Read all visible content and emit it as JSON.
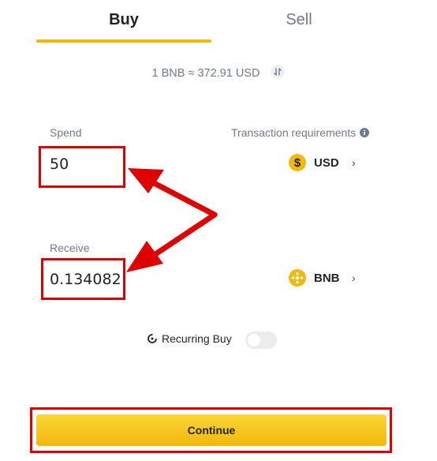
{
  "tabs": {
    "buy": "Buy",
    "sell": "Sell"
  },
  "rate": {
    "text": "1 BNB ≈ 372.91 USD"
  },
  "spend": {
    "label": "Spend",
    "value": "50",
    "currency": "USD",
    "currency_symbol": "$"
  },
  "transaction_requirements": {
    "label": "Transaction requirements"
  },
  "receive": {
    "label": "Receive",
    "value": "0.134082",
    "currency": "BNB"
  },
  "recurring": {
    "label": "Recurring Buy",
    "enabled": false
  },
  "continue": {
    "label": "Continue"
  },
  "colors": {
    "accent": "#f0b90b",
    "annotation": "#e00000",
    "text": "#1e2329",
    "muted": "#707a8a"
  },
  "icons": [
    "swap-icon",
    "info-icon",
    "dollar-coin-icon",
    "bnb-coin-icon",
    "chevron-right-icon",
    "recurring-icon"
  ]
}
